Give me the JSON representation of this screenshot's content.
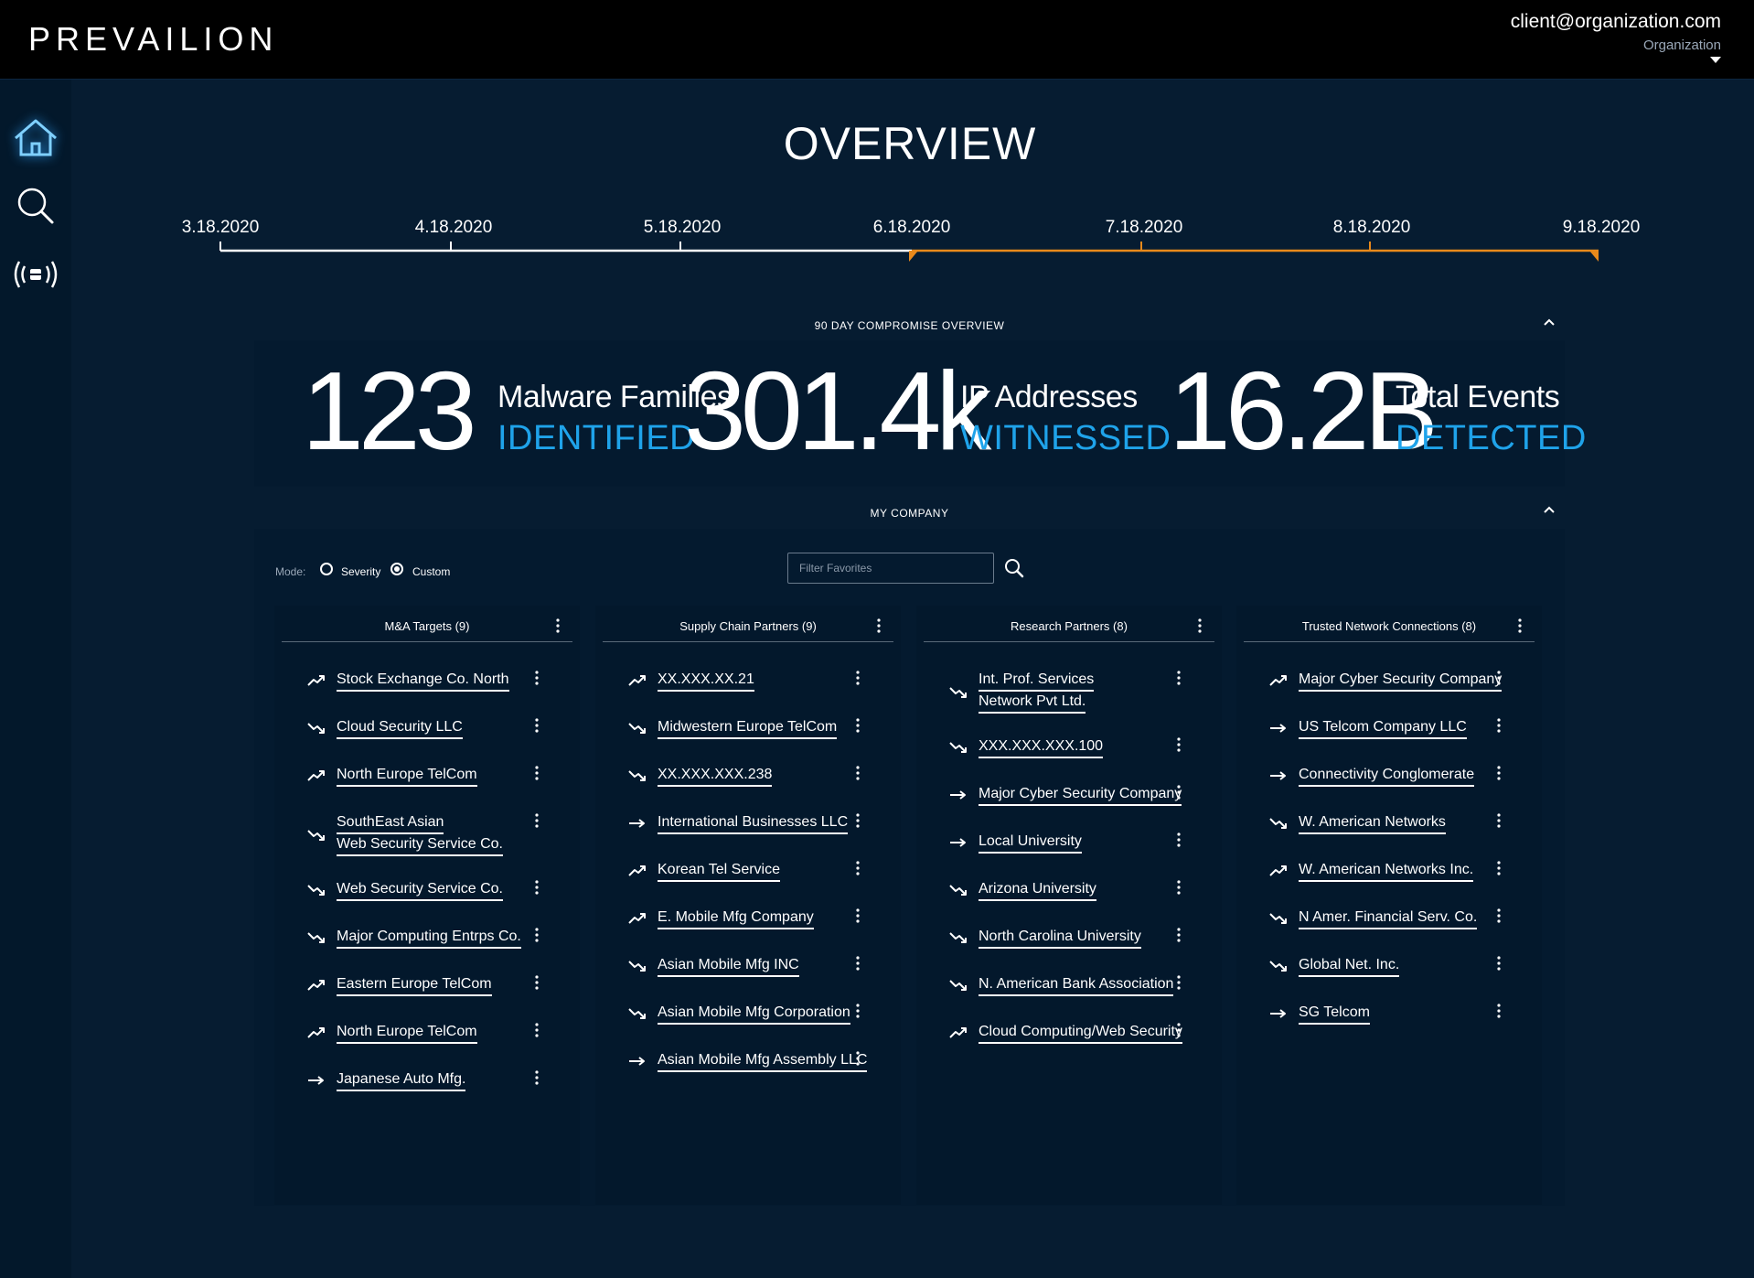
{
  "header": {
    "logo": "PREVAILION",
    "user_email": "client@organization.com",
    "user_org": "Organization"
  },
  "sidebar": {
    "items": [
      {
        "name": "home",
        "icon": "home-icon",
        "active": true
      },
      {
        "name": "search",
        "icon": "search-icon",
        "active": false
      },
      {
        "name": "signal",
        "icon": "broadcast-icon",
        "active": false
      }
    ]
  },
  "page": {
    "title": "OVERVIEW"
  },
  "timeline": {
    "dates": [
      "3.18.2020",
      "4.18.2020",
      "5.18.2020",
      "6.18.2020",
      "7.18.2020",
      "8.18.2020",
      "9.18.2020"
    ],
    "range_start": "6.18.2020",
    "range_end": "9.18.2020",
    "colors": {
      "base": "#ffffff",
      "range": "#e8891b"
    }
  },
  "overview": {
    "title": "90 DAY COMPROMISE OVERVIEW",
    "stats": [
      {
        "value": "123",
        "label": "Malware Families",
        "sub": "IDENTIFIED"
      },
      {
        "value": "301.4k",
        "label": "IP Addresses",
        "sub": "WITNESSED"
      },
      {
        "value": "16.2B",
        "label": "Total Events",
        "sub": "DETECTED"
      }
    ]
  },
  "company": {
    "title": "MY COMPANY",
    "mode_label": "Mode:",
    "modes": [
      {
        "label": "Severity",
        "selected": false
      },
      {
        "label": "Custom",
        "selected": true
      }
    ],
    "filter_placeholder": "Filter Favorites",
    "columns": [
      {
        "title": "M&A Targets (9)",
        "items": [
          {
            "lines": [
              "Stock Exchange Co. North"
            ],
            "trend": "up",
            "severity": "orange"
          },
          {
            "lines": [
              "Cloud Security LLC"
            ],
            "trend": "down",
            "severity": "red"
          },
          {
            "lines": [
              "North Europe TelCom"
            ],
            "trend": "up",
            "severity": "red"
          },
          {
            "lines": [
              "SouthEast Asian",
              "Web Security Service Co."
            ],
            "trend": "down",
            "severity": "yellow"
          },
          {
            "lines": [
              "Web Security Service Co."
            ],
            "trend": "down",
            "severity": "red"
          },
          {
            "lines": [
              "Major Computing Entrps Co."
            ],
            "trend": "down",
            "severity": "red"
          },
          {
            "lines": [
              "Eastern Europe TelCom"
            ],
            "trend": "up",
            "severity": "red"
          },
          {
            "lines": [
              "North Europe TelCom"
            ],
            "trend": "up",
            "severity": "orange"
          },
          {
            "lines": [
              "Japanese Auto Mfg."
            ],
            "trend": "flat",
            "severity": "yellow"
          }
        ]
      },
      {
        "title": "Supply Chain Partners (9)",
        "items": [
          {
            "lines": [
              "XX.XXX.XX.21"
            ],
            "trend": "up",
            "severity": "yellow"
          },
          {
            "lines": [
              "Midwestern Europe TelCom"
            ],
            "trend": "down",
            "severity": "red"
          },
          {
            "lines": [
              "XX.XXX.XXX.238"
            ],
            "trend": "down",
            "severity": "yellow"
          },
          {
            "lines": [
              "International Businesses LLC"
            ],
            "trend": "flat",
            "severity": "green"
          },
          {
            "lines": [
              "Korean Tel Service"
            ],
            "trend": "up",
            "severity": "yellow"
          },
          {
            "lines": [
              "E. Mobile Mfg Company"
            ],
            "trend": "up",
            "severity": "red"
          },
          {
            "lines": [
              "Asian Mobile Mfg INC"
            ],
            "trend": "down",
            "severity": "yellow"
          },
          {
            "lines": [
              "Asian Mobile Mfg Corporation"
            ],
            "trend": "down",
            "severity": "green"
          },
          {
            "lines": [
              "Asian Mobile Mfg Assembly LLC"
            ],
            "trend": "flat",
            "severity": "green"
          }
        ]
      },
      {
        "title": "Research Partners (8)",
        "items": [
          {
            "lines": [
              "Int. Prof. Services",
              "Network Pvt Ltd."
            ],
            "trend": "down",
            "severity": "orange"
          },
          {
            "lines": [
              "XXX.XXX.XXX.100"
            ],
            "trend": "down",
            "severity": "red"
          },
          {
            "lines": [
              "Major Cyber Security Company"
            ],
            "trend": "flat",
            "severity": "yellow"
          },
          {
            "lines": [
              "Local University"
            ],
            "trend": "flat",
            "severity": "green"
          },
          {
            "lines": [
              "Arizona University"
            ],
            "trend": "down",
            "severity": "yellow"
          },
          {
            "lines": [
              "North Carolina University"
            ],
            "trend": "down",
            "severity": "green"
          },
          {
            "lines": [
              "N. American Bank Association"
            ],
            "trend": "down",
            "severity": "orange"
          },
          {
            "lines": [
              "Cloud Computing/Web Security"
            ],
            "trend": "up",
            "severity": "red"
          }
        ]
      },
      {
        "title": "Trusted Network Connections (8)",
        "items": [
          {
            "lines": [
              "Major Cyber Security Company"
            ],
            "trend": "up",
            "severity": "yellow"
          },
          {
            "lines": [
              "US Telcom Company LLC"
            ],
            "trend": "flat",
            "severity": "green"
          },
          {
            "lines": [
              "Connectivity Conglomerate"
            ],
            "trend": "flat",
            "severity": "green"
          },
          {
            "lines": [
              "W. American Networks"
            ],
            "trend": "down",
            "severity": "green"
          },
          {
            "lines": [
              "W. American Networks Inc."
            ],
            "trend": "up",
            "severity": "orange"
          },
          {
            "lines": [
              "N Amer. Financial Serv. Co."
            ],
            "trend": "down",
            "severity": "yellow"
          },
          {
            "lines": [
              "Global Net. Inc."
            ],
            "trend": "down",
            "severity": "orange"
          },
          {
            "lines": [
              "SG Telcom"
            ],
            "trend": "flat",
            "severity": "green"
          }
        ]
      }
    ]
  },
  "colors": {
    "accent": "#1fa3ea",
    "background": "#061c31",
    "severity_red": "#d93333",
    "severity_orange": "#e99a1f",
    "severity_yellow": "#d8c02a",
    "severity_green": "#31b54a"
  }
}
